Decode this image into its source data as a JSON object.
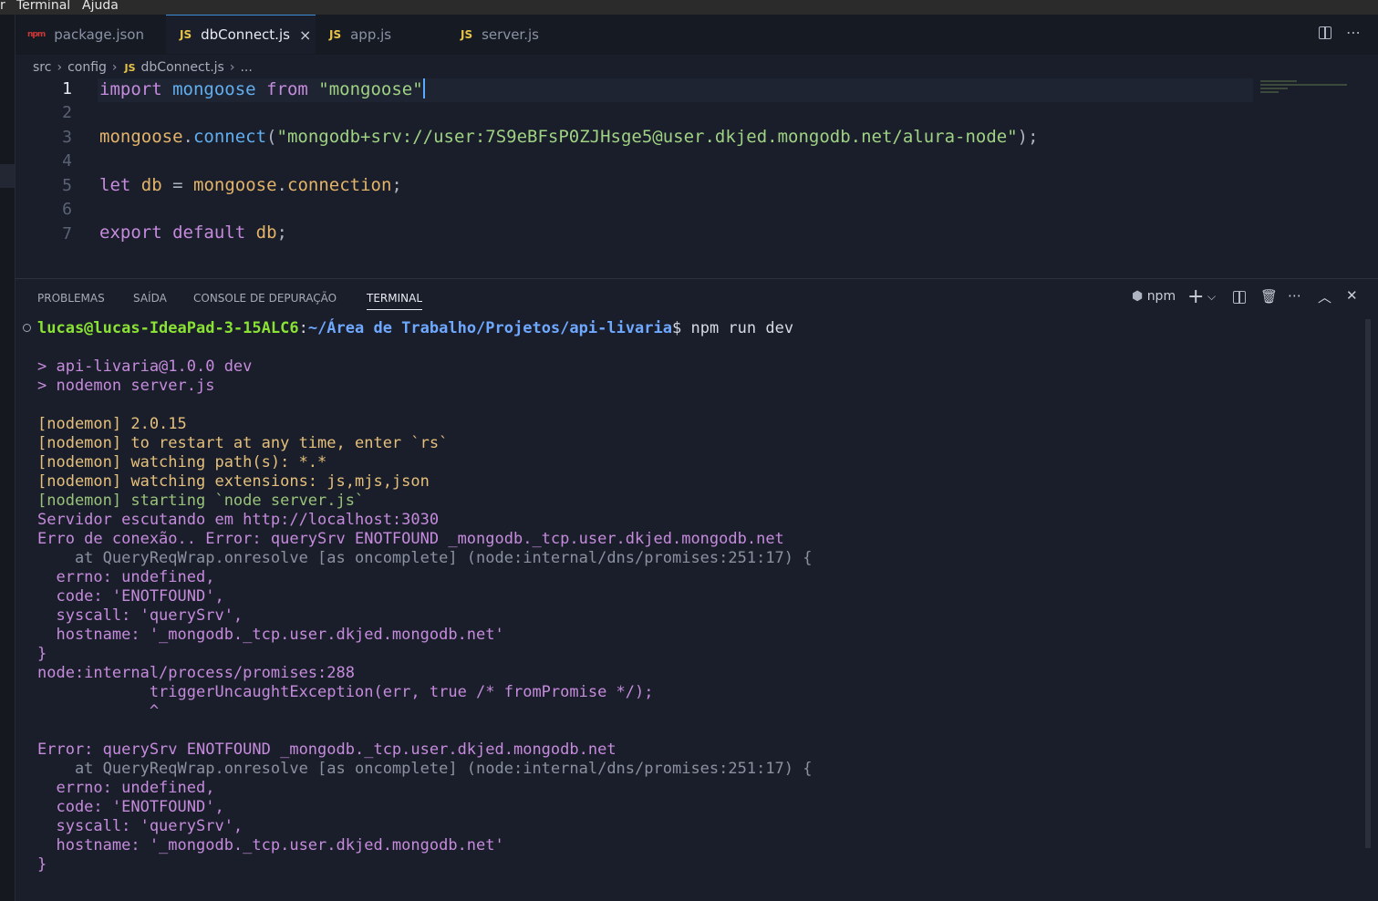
{
  "menubar": {
    "items": [
      "r",
      "Terminal",
      "Ajuda"
    ]
  },
  "tabs": [
    {
      "label": "package.json",
      "icon": "npm-icon"
    },
    {
      "label": "dbConnect.js",
      "icon": "js-icon",
      "close": "×"
    },
    {
      "label": "app.js",
      "icon": "js-icon"
    },
    {
      "label": "server.js",
      "icon": "js-icon"
    }
  ],
  "js_badge": "JS",
  "npm_badge": "npm",
  "breadcrumb": {
    "src": "src",
    "config": "config",
    "file": "dbConnect.js",
    "more": "..."
  },
  "editor": {
    "line_numbers": [
      "1",
      "2",
      "3",
      "4",
      "5",
      "6",
      "7"
    ],
    "l1": {
      "import": "import",
      "mongoose": "mongoose",
      "from": "from",
      "str": "\"mongoose\""
    },
    "l3": {
      "obj": "mongoose",
      "dot": ".",
      "fn": "connect",
      "open": "(",
      "str": "\"mongodb+srv://user:7S9eBFsP0ZJHsge5@user.dkjed.mongodb.net/alura-node\"",
      "close": ");"
    },
    "l5": {
      "let": "let",
      "db": "db",
      "eq": "=",
      "obj": "mongoose",
      "dot": ".",
      "prop": "connection",
      "semi": ";"
    },
    "l7": {
      "export": "export",
      "default": "default",
      "db": "db",
      "semi": ";"
    }
  },
  "panel": {
    "tabs": [
      "PROBLEMAS",
      "SAÍDA",
      "CONSOLE DE DEPURAÇÃO",
      "TERMINAL"
    ],
    "terminal_name": "npm"
  },
  "terminal": {
    "prompt_user": "lucas@lucas-IdeaPad-3-15ALC6",
    "prompt_sep": ":",
    "prompt_path": "~/Área de Trabalho/Projetos/api-livaria",
    "prompt_cmd": "$ npm run dev",
    "lines": [
      "> api-livaria@1.0.0 dev",
      "> nodemon server.js",
      "[nodemon] 2.0.15",
      "[nodemon] to restart at any time, enter `rs`",
      "[nodemon] watching path(s): *.*",
      "[nodemon] watching extensions: js,mjs,json",
      "[nodemon] starting `node server.js`",
      "Servidor escutando em http://localhost:3030",
      "Erro de conexão.. Error: querySrv ENOTFOUND _mongodb._tcp.user.dkjed.mongodb.net",
      "    at QueryReqWrap.onresolve [as oncomplete] (node:internal/dns/promises:251:17) {",
      "  errno: undefined,",
      "  code: 'ENOTFOUND',",
      "  syscall: 'querySrv',",
      "  hostname: '_mongodb._tcp.user.dkjed.mongodb.net'",
      "}",
      "node:internal/process/promises:288",
      "            triggerUncaughtException(err, true /* fromPromise */);",
      "            ^",
      "Error: querySrv ENOTFOUND _mongodb._tcp.user.dkjed.mongodb.net",
      "    at QueryReqWrap.onresolve [as oncomplete] (node:internal/dns/promises:251:17) {",
      "  errno: undefined,",
      "  code: 'ENOTFOUND',",
      "  syscall: 'querySrv',",
      "  hostname: '_mongodb._tcp.user.dkjed.mongodb.net'",
      "}"
    ]
  }
}
